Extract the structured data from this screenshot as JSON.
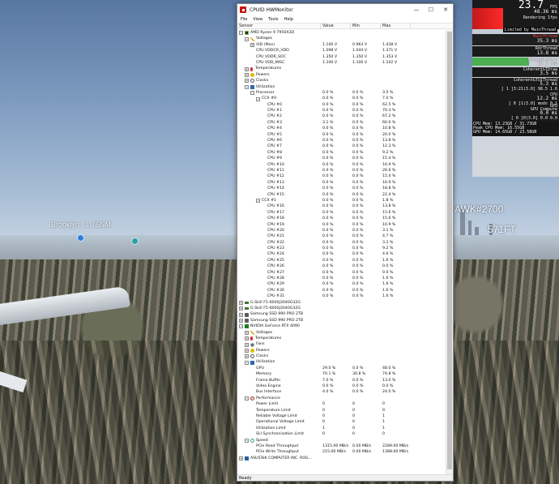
{
  "scene": {
    "labels": {
      "brooklyn": "Brooklyn",
      "brooklyn_distance": "1.76NM",
      "hawk": "AWK#2700",
      "altitude": "571FT"
    }
  },
  "window": {
    "title": "CPUID HWMonitor",
    "controls": {
      "minimize": "—",
      "maximize": "☐",
      "close": "✕"
    },
    "menu": [
      "File",
      "View",
      "Tools",
      "Help"
    ],
    "columns": {
      "sensor": "Sensor",
      "value": "Value",
      "min": "Min",
      "max": "Max"
    },
    "status": "Ready"
  },
  "rows": [
    {
      "indent": 1,
      "exp": "−",
      "icon": "chip",
      "label": "AMD Ryzen 9 7950X3D"
    },
    {
      "indent": 2,
      "exp": "−",
      "icon": "volt",
      "label": "Voltages"
    },
    {
      "indent": 3,
      "exp": "+",
      "label": "VID (Max)",
      "value": "1.100 V",
      "min": "0.963 V",
      "max": "1.438 V"
    },
    {
      "indent": 3,
      "label": "CPU VDDCR_VDD",
      "value": "1.098 V",
      "min": "1.044 V",
      "max": "1.371 V"
    },
    {
      "indent": 3,
      "label": "CPU VDDR_SOC",
      "value": "1.350 V",
      "min": "1.350 V",
      "max": "1.353 V"
    },
    {
      "indent": 3,
      "label": "CPU VDD_MISC",
      "value": "1.100 V",
      "min": "1.100 V",
      "max": "1.102 V"
    },
    {
      "indent": 2,
      "exp": "+",
      "icon": "temp",
      "label": "Temperatures"
    },
    {
      "indent": 2,
      "exp": "+",
      "icon": "power",
      "label": "Powers"
    },
    {
      "indent": 2,
      "exp": "+",
      "icon": "clock",
      "label": "Clocks"
    },
    {
      "indent": 2,
      "exp": "−",
      "icon": "util",
      "label": "Utilization"
    },
    {
      "indent": 3,
      "exp": "−",
      "label": "Processor",
      "value": "0.0 %",
      "min": "0.0 %",
      "max": "3.5 %"
    },
    {
      "indent": 4,
      "exp": "−",
      "label": "CCX #0",
      "value": "0.0 %",
      "min": "0.0 %",
      "max": "7.0 %"
    },
    {
      "indent": 5,
      "label": "CPU #0",
      "value": "0.0 %",
      "min": "0.0 %",
      "max": "62.5 %"
    },
    {
      "indent": 5,
      "label": "CPU #1",
      "value": "0.0 %",
      "min": "0.0 %",
      "max": "70.3 %"
    },
    {
      "indent": 5,
      "label": "CPU #2",
      "value": "0.0 %",
      "min": "0.0 %",
      "max": "67.2 %"
    },
    {
      "indent": 5,
      "label": "CPU #3",
      "value": "3.1 %",
      "min": "0.0 %",
      "max": "60.0 %"
    },
    {
      "indent": 5,
      "label": "CPU #4",
      "value": "0.0 %",
      "min": "0.0 %",
      "max": "10.8 %"
    },
    {
      "indent": 5,
      "label": "CPU #5",
      "value": "0.0 %",
      "min": "0.0 %",
      "max": "20.0 %"
    },
    {
      "indent": 5,
      "label": "CPU #6",
      "value": "0.0 %",
      "min": "0.0 %",
      "max": "13.8 %"
    },
    {
      "indent": 5,
      "label": "CPU #7",
      "value": "0.0 %",
      "min": "0.0 %",
      "max": "12.3 %"
    },
    {
      "indent": 5,
      "label": "CPU #8",
      "value": "0.0 %",
      "min": "0.0 %",
      "max": "9.2 %"
    },
    {
      "indent": 5,
      "label": "CPU #9",
      "value": "0.0 %",
      "min": "0.0 %",
      "max": "15.4 %"
    },
    {
      "indent": 5,
      "label": "CPU #10",
      "value": "0.0 %",
      "min": "0.0 %",
      "max": "16.9 %"
    },
    {
      "indent": 5,
      "label": "CPU #11",
      "value": "0.0 %",
      "min": "0.0 %",
      "max": "26.6 %"
    },
    {
      "indent": 5,
      "label": "CPU #12",
      "value": "0.0 %",
      "min": "0.0 %",
      "max": "15.4 %"
    },
    {
      "indent": 5,
      "label": "CPU #13",
      "value": "0.0 %",
      "min": "0.0 %",
      "max": "16.9 %"
    },
    {
      "indent": 5,
      "label": "CPU #14",
      "value": "0.0 %",
      "min": "0.0 %",
      "max": "18.8 %"
    },
    {
      "indent": 5,
      "label": "CPU #15",
      "value": "0.0 %",
      "min": "0.0 %",
      "max": "22.4 %"
    },
    {
      "indent": 4,
      "exp": "−",
      "label": "CCX #1",
      "value": "0.0 %",
      "min": "0.0 %",
      "max": "1.8 %"
    },
    {
      "indent": 5,
      "label": "CPU #16",
      "value": "0.0 %",
      "min": "0.0 %",
      "max": "13.8 %"
    },
    {
      "indent": 5,
      "label": "CPU #17",
      "value": "0.0 %",
      "min": "0.0 %",
      "max": "15.6 %"
    },
    {
      "indent": 5,
      "label": "CPU #18",
      "value": "0.0 %",
      "min": "0.0 %",
      "max": "15.6 %"
    },
    {
      "indent": 5,
      "label": "CPU #19",
      "value": "0.0 %",
      "min": "0.0 %",
      "max": "10.9 %"
    },
    {
      "indent": 5,
      "label": "CPU #20",
      "value": "0.0 %",
      "min": "0.0 %",
      "max": "3.1 %"
    },
    {
      "indent": 5,
      "label": "CPU #21",
      "value": "0.0 %",
      "min": "0.0 %",
      "max": "4.7 %"
    },
    {
      "indent": 5,
      "label": "CPU #22",
      "value": "0.0 %",
      "min": "0.0 %",
      "max": "3.2 %"
    },
    {
      "indent": 5,
      "label": "CPU #23",
      "value": "0.0 %",
      "min": "0.0 %",
      "max": "9.2 %"
    },
    {
      "indent": 5,
      "label": "CPU #24",
      "value": "0.0 %",
      "min": "0.0 %",
      "max": "4.6 %"
    },
    {
      "indent": 5,
      "label": "CPU #25",
      "value": "0.0 %",
      "min": "0.0 %",
      "max": "1.6 %"
    },
    {
      "indent": 5,
      "label": "CPU #26",
      "value": "0.0 %",
      "min": "0.0 %",
      "max": "0.0 %"
    },
    {
      "indent": 5,
      "label": "CPU #27",
      "value": "0.0 %",
      "min": "0.0 %",
      "max": "0.0 %"
    },
    {
      "indent": 5,
      "label": "CPU #28",
      "value": "0.0 %",
      "min": "0.0 %",
      "max": "1.6 %"
    },
    {
      "indent": 5,
      "label": "CPU #29",
      "value": "0.0 %",
      "min": "0.0 %",
      "max": "1.6 %"
    },
    {
      "indent": 5,
      "label": "CPU #30",
      "value": "0.0 %",
      "min": "0.0 %",
      "max": "1.6 %"
    },
    {
      "indent": 5,
      "label": "CPU #31",
      "value": "0.0 %",
      "min": "0.0 %",
      "max": "1.6 %"
    },
    {
      "indent": 1,
      "exp": "+",
      "icon": "ram",
      "label": "G.Skill F5-6000J3040G32G"
    },
    {
      "indent": 1,
      "exp": "+",
      "icon": "ram",
      "label": "G.Skill F5-6000J3040G32G"
    },
    {
      "indent": 1,
      "exp": "+",
      "icon": "ssd",
      "label": "Samsung SSD 990 PRO 2TB"
    },
    {
      "indent": 1,
      "exp": "+",
      "icon": "ssd",
      "label": "Samsung SSD 990 PRO 2TB"
    },
    {
      "indent": 1,
      "exp": "−",
      "icon": "gpu",
      "label": "NVIDIA GeForce RTX 4090"
    },
    {
      "indent": 2,
      "exp": "+",
      "icon": "volt",
      "label": "Voltages"
    },
    {
      "indent": 2,
      "exp": "+",
      "icon": "temp",
      "label": "Temperatures"
    },
    {
      "indent": 2,
      "exp": "+",
      "icon": "fan",
      "label": "Fans"
    },
    {
      "indent": 2,
      "exp": "+",
      "icon": "power",
      "label": "Powers"
    },
    {
      "indent": 2,
      "exp": "+",
      "icon": "clock",
      "label": "Clocks"
    },
    {
      "indent": 2,
      "exp": "−",
      "icon": "util",
      "label": "Utilization"
    },
    {
      "indent": 3,
      "label": "GPU",
      "value": "29.0 %",
      "min": "0.0 %",
      "max": "48.0 %"
    },
    {
      "indent": 3,
      "label": "Memory",
      "value": "70.1 %",
      "min": "30.8 %",
      "max": "74.8 %"
    },
    {
      "indent": 3,
      "label": "Frame Buffer",
      "value": "7.0 %",
      "min": "0.0 %",
      "max": "13.0 %"
    },
    {
      "indent": 3,
      "label": "Video Engine",
      "value": "0.0 %",
      "min": "0.0 %",
      "max": "0.0 %"
    },
    {
      "indent": 3,
      "label": "Bus Interface",
      "value": "4.0 %",
      "min": "0.0 %",
      "max": "24.0 %"
    },
    {
      "indent": 2,
      "exp": "−",
      "icon": "perf",
      "label": "Performance"
    },
    {
      "indent": 3,
      "label": "Power Limit",
      "value": "0",
      "min": "0",
      "max": "0"
    },
    {
      "indent": 3,
      "label": "Temperature Limit",
      "value": "0",
      "min": "0",
      "max": "0"
    },
    {
      "indent": 3,
      "label": "Reliable Voltage Limit",
      "value": "0",
      "min": "0",
      "max": "1"
    },
    {
      "indent": 3,
      "label": "Operational Voltage Limit",
      "value": "0",
      "min": "0",
      "max": "1"
    },
    {
      "indent": 3,
      "label": "Utilization Limit",
      "value": "1",
      "min": "0",
      "max": "1"
    },
    {
      "indent": 3,
      "label": "SLI Synchronisation Limit",
      "value": "0",
      "min": "0",
      "max": "0"
    },
    {
      "indent": 2,
      "exp": "−",
      "icon": "speed",
      "label": "Speed"
    },
    {
      "indent": 3,
      "label": "PCIe Read Throughput",
      "value": "1315.00 MB/s",
      "min": "0.00 MB/s",
      "max": "2289.00 MB/s"
    },
    {
      "indent": 3,
      "label": "PCIe Write Throughput",
      "value": "215.00 MB/s",
      "min": "0.00 MB/s",
      "max": "1388.00 MB/s"
    },
    {
      "indent": 1,
      "exp": "+",
      "icon": "board",
      "label": "ASUSTeK COMPUTER INC. ROG..."
    }
  ],
  "osd": {
    "fps": "23.7",
    "fps_unit": "FPS",
    "main_small": [
      "48.36 ms",
      "Rendering 1fps"
    ],
    "limited_by": "Limited by MainThread",
    "mainthread": "MainThread",
    "mainthread_val": "35.3 ms",
    "rdr": "RdrThread",
    "rdr_val": "13.8 ms",
    "manip": "Manipulators",
    "manip_val": "13.1 ms",
    "coh_draw": "CoherentGTDraw",
    "coh_draw_val": "3.5 ms",
    "coh_ui": "CoherentGTUIThread",
    "coh_ui_val": "5.3 ms",
    "coh_ui_sub": "[ 1 ]3:21(3.0]  98.5  1.6",
    "cpu": "CPU",
    "cpu_val": "12.2 ms",
    "cpu_sub": "[ 0 ]1(3.0]  mods 0.1",
    "gpu": "GPU",
    "gpu_sub": "GPU Compute",
    "gpu_val": "0.0 ms",
    "gpu_sub2": "[ 0 ]0(3.0]  0.0   0.0",
    "mem": [
      "CPU Mem: 13.23GB / 31.73GB",
      "Peak CPU Mem: 16.55GB",
      "GPU Mem: 14.65GB / 23.58GB"
    ],
    "colors": {
      "accent": "#ff3c3c",
      "green": "#4caf50",
      "yellow": "#e8c400"
    }
  }
}
